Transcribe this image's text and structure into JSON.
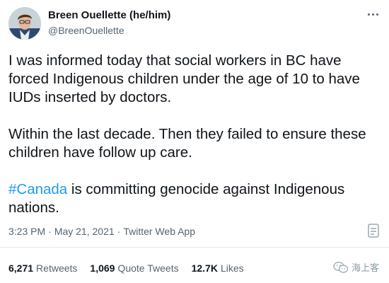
{
  "tweet": {
    "author": {
      "display_name": "Breen Ouellette (he/him)",
      "handle": "@BreenOuellette"
    },
    "paragraphs": [
      {
        "text": "I was informed today that social workers in BC have forced Indigenous children under the age of 10 to have IUDs inserted by doctors."
      },
      {
        "text": "Within the last decade. Then they failed to ensure these children have follow up care."
      },
      {
        "hashtag": "#Canada",
        "text": " is committing genocide against Indigenous nations."
      }
    ],
    "time": "3:23 PM",
    "date": "May 21, 2021",
    "source": "Twitter Web App",
    "separator": "·",
    "stats": {
      "retweets_count": "6,271",
      "retweets_label": "Retweets",
      "quotes_count": "1,069",
      "quotes_label": "Quote Tweets",
      "likes_count": "12.7K",
      "likes_label": "Likes"
    }
  },
  "watermark": {
    "text": "海上客"
  },
  "icons": {
    "more": "more-options-icon",
    "analytics": "analytics-icon",
    "watermark": "wechat-icon"
  },
  "colors": {
    "text": "#0f1419",
    "secondary": "#536471",
    "link": "#1d9bf0",
    "divider": "#e5e9ec"
  }
}
